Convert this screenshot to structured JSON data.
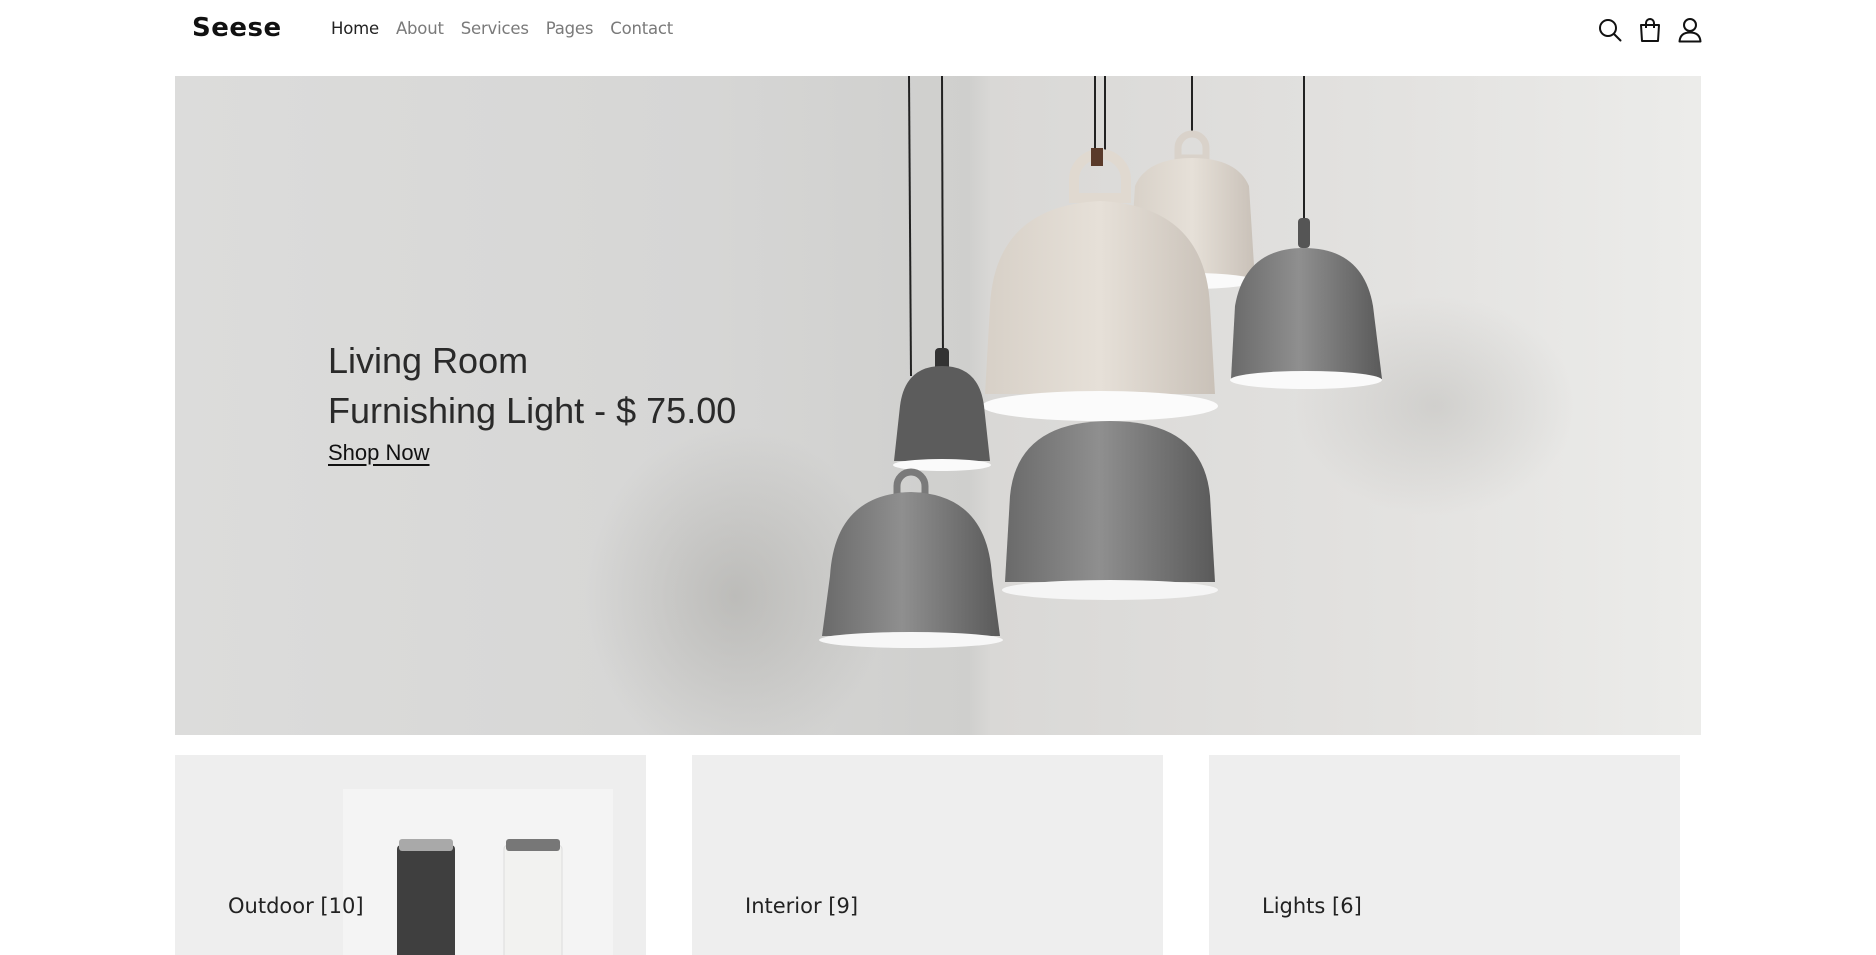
{
  "brand": {
    "logo": "Seese"
  },
  "nav": {
    "items": [
      {
        "label": "Home",
        "active": true
      },
      {
        "label": "About"
      },
      {
        "label": "Services"
      },
      {
        "label": "Pages"
      },
      {
        "label": "Contact"
      }
    ]
  },
  "header_icons": [
    "search-icon",
    "shopping-bag-icon",
    "user-icon"
  ],
  "hero": {
    "title_line1": "Living Room",
    "title_line2": "Furnishing Light - $ 75.00",
    "cta_label": "Shop Now"
  },
  "categories": [
    {
      "label": "Outdoor [10]"
    },
    {
      "label": "Interior [9]"
    },
    {
      "label": "Lights [6]"
    }
  ],
  "colors": {
    "hero_background": "#d8d8d6",
    "category_background": "#eeeeee",
    "text_dark": "#222222",
    "nav_muted": "#7a7a7a"
  }
}
